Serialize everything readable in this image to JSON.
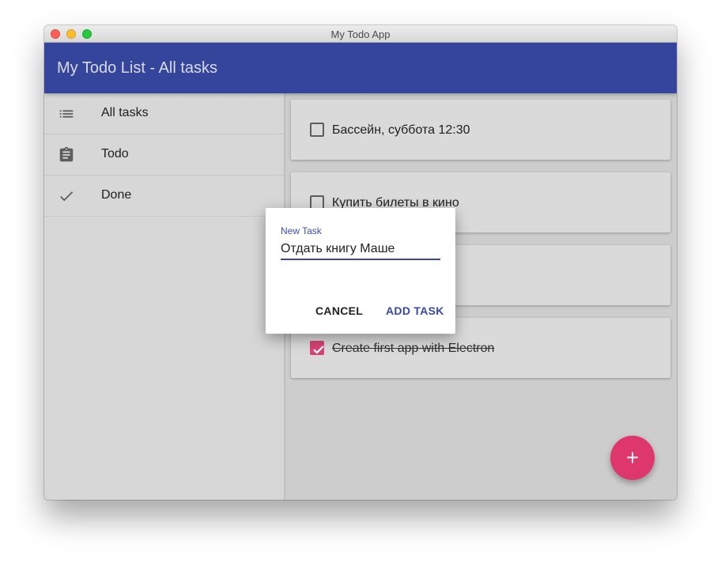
{
  "window": {
    "title": "My Todo App"
  },
  "appbar": {
    "title": "My Todo List - All tasks",
    "color": "#3948a3"
  },
  "sidebar": {
    "items": [
      {
        "label": "All tasks",
        "icon": "list-icon"
      },
      {
        "label": "Todo",
        "icon": "clipboard-icon"
      },
      {
        "label": "Done",
        "icon": "check-icon"
      }
    ]
  },
  "tasks": [
    {
      "text": "Бассейн, суббота 12:30",
      "done": false
    },
    {
      "text": "Купить билеты в кино",
      "done": false
    },
    {
      "text": "",
      "done": false
    },
    {
      "text": "Create first app with Electron",
      "done": true
    }
  ],
  "dialog": {
    "field_label": "New Task",
    "field_value": "Отдать книгу Маше",
    "cancel_label": "CANCEL",
    "add_label": "ADD TASK"
  },
  "fab": {
    "label": "+",
    "color": "#e63a72",
    "icon": "plus-icon"
  }
}
